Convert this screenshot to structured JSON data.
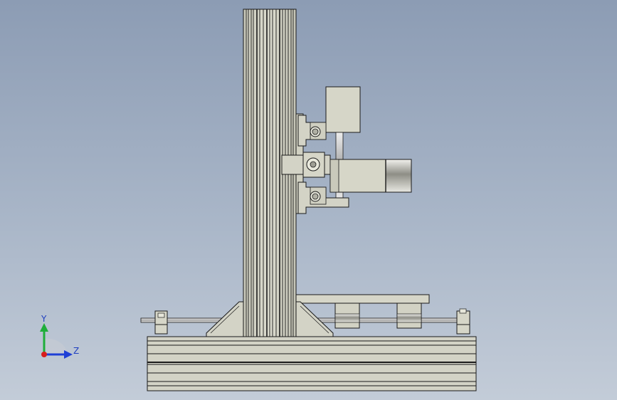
{
  "axes": {
    "y_label": "Y",
    "z_label": "Z"
  },
  "colors": {
    "background_top": "#8c9cb4",
    "background_bottom": "#c3ccd8",
    "part_fill": "#d6d6c8",
    "part_shade": "#bdbdaf",
    "edge": "#1a1a1a",
    "axis_y": "#1fae3a",
    "axis_z": "#1f3fd6",
    "axis_origin": "#d81e1e"
  },
  "icons": {
    "triad": "coordinate-triad-icon"
  }
}
